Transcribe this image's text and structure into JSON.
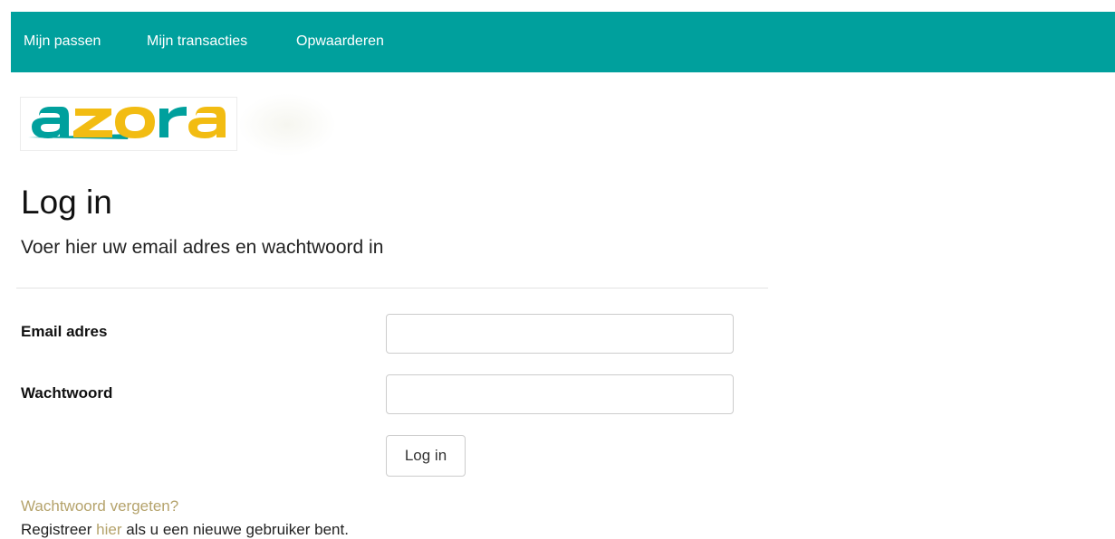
{
  "nav": {
    "items": [
      {
        "label": "Mijn passen"
      },
      {
        "label": "Mijn transacties"
      },
      {
        "label": "Opwaarderen"
      }
    ]
  },
  "brand": {
    "logo_text": "azora",
    "colors": {
      "teal": "#00a09d",
      "yellow": "#f2bc12",
      "nav_bg": "#00a09d",
      "link": "#b5a36c"
    }
  },
  "page": {
    "title": "Log in",
    "subtitle": "Voer hier uw email adres en wachtwoord in"
  },
  "form": {
    "email_label": "Email adres",
    "email_value": "",
    "password_label": "Wachtwoord",
    "password_value": "",
    "submit_label": "Log in"
  },
  "links": {
    "forgot_password": "Wachtwoord vergeten?",
    "register_prefix": "Registreer ",
    "register_link": "hier",
    "register_suffix": " als u een nieuwe gebruiker bent."
  }
}
